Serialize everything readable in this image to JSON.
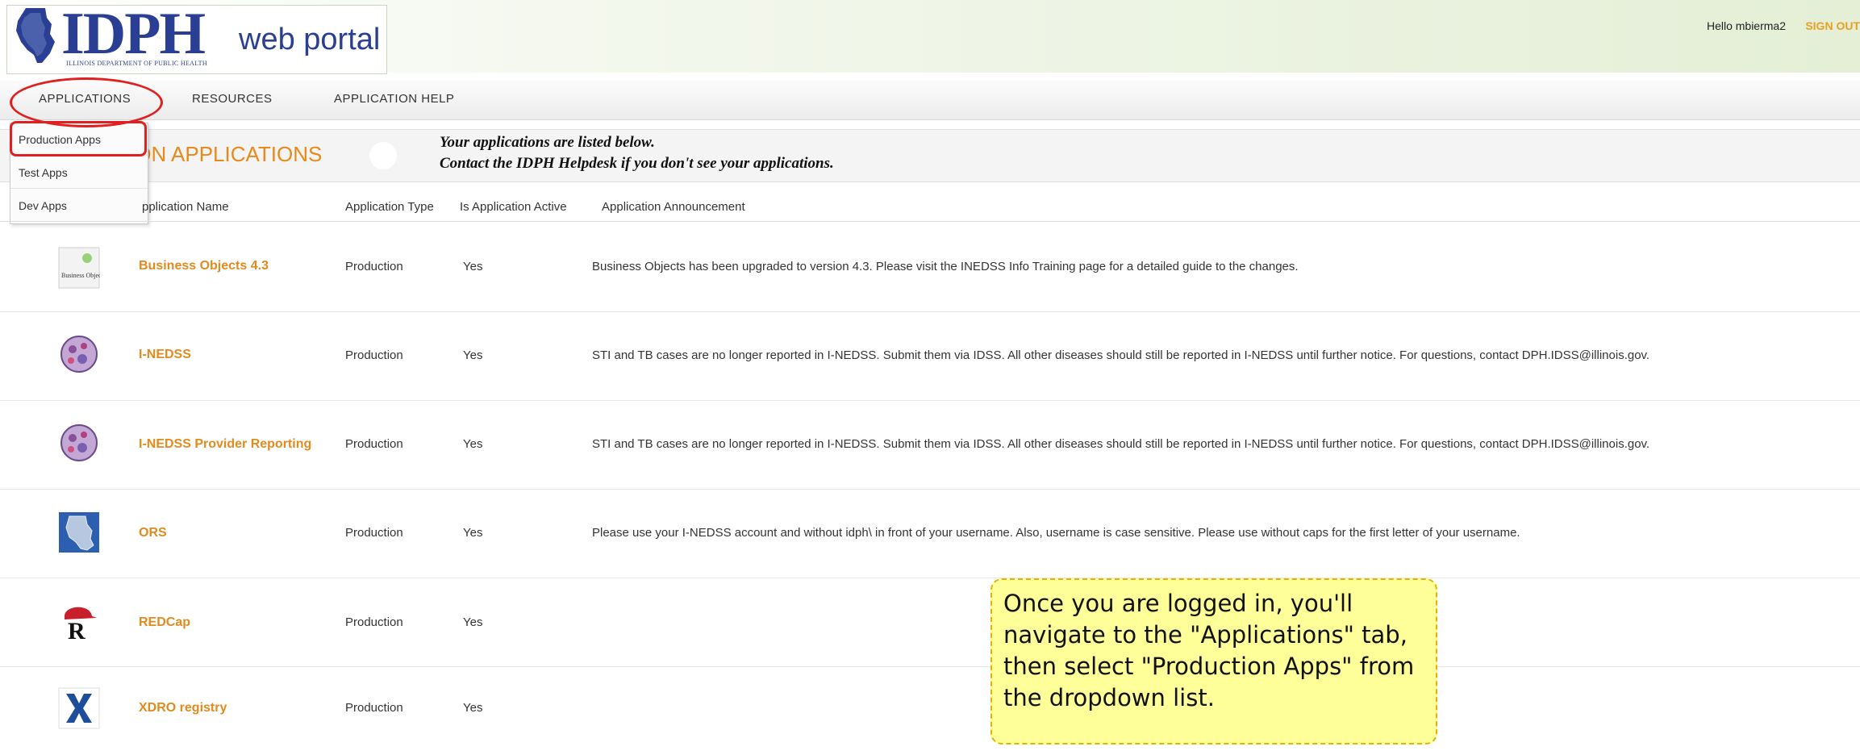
{
  "header": {
    "logo_text": "IDPH",
    "logo_subtitle": "ILLINOIS DEPARTMENT OF PUBLIC HEALTH",
    "portal_label": "web portal",
    "greeting": "Hello mbierma2",
    "sign_out": "SIGN OUT"
  },
  "nav": {
    "applications": "APPLICATIONS",
    "resources": "RESOURCES",
    "application_help": "APPLICATION HELP"
  },
  "dropdown": {
    "items": [
      "Production Apps",
      "Test Apps",
      "Dev Apps"
    ]
  },
  "section": {
    "title": "ION APPLICATIONS",
    "message_line1": "Your applications are listed below.",
    "message_line2": "Contact the IDPH Helpdesk if you don't see your applications."
  },
  "table": {
    "headers": [
      "pplication Name",
      "Application Type",
      "Is Application Active",
      "Application Announcement"
    ],
    "rows": [
      {
        "icon": "business-objects-icon",
        "name": "Business Objects 4.3",
        "type": "Production",
        "active": "Yes",
        "announcement": "Business Objects has been upgraded to version 4.3. Please visit the INEDSS Info Training page for a detailed guide to the changes."
      },
      {
        "icon": "virus-cell-icon",
        "name": "I-NEDSS",
        "type": "Production",
        "active": "Yes",
        "announcement": "STI and TB cases are no longer reported in I-NEDSS. Submit them via IDSS. All other diseases should still be reported in I-NEDSS until further notice. For questions, contact DPH.IDSS@illinois.gov."
      },
      {
        "icon": "virus-cell-icon",
        "name": "I-NEDSS Provider Reporting",
        "type": "Production",
        "active": "Yes",
        "announcement": "STI and TB cases are no longer reported in I-NEDSS. Submit them via IDSS. All other diseases should still be reported in I-NEDSS until further notice. For questions, contact DPH.IDSS@illinois.gov."
      },
      {
        "icon": "illinois-map-icon",
        "name": "ORS",
        "type": "Production",
        "active": "Yes",
        "announcement": "Please use your I-NEDSS account and without idph\\ in front of your username. Also, username is case sensitive. Please use without caps for the first letter of your username."
      },
      {
        "icon": "redcap-icon",
        "name": "REDCap",
        "type": "Production",
        "active": "Yes",
        "announcement": ""
      },
      {
        "icon": "xdro-icon",
        "name": "XDRO registry",
        "type": "Production",
        "active": "Yes",
        "announcement": ""
      }
    ]
  },
  "callout": {
    "text": "Once you are logged in, you'll navigate to the \"Applications\" tab, then select \"Production Apps\" from the dropdown list."
  },
  "colors": {
    "brand_blue": "#2a3f93",
    "accent_orange": "#e8891a",
    "highlight_red": "#e02020",
    "callout_yellow": "#ffff99"
  }
}
